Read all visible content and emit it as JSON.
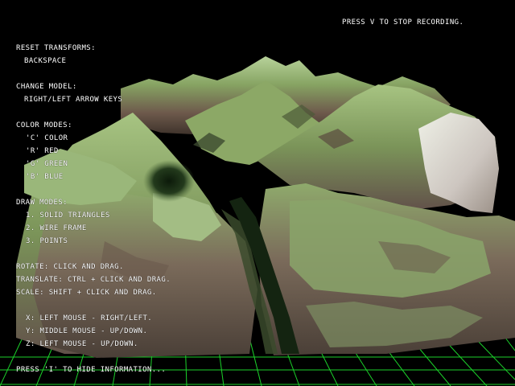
{
  "recording_notice": "PRESS V TO STOP RECORDING.",
  "info": {
    "reset_title": "RESET TRANSFORMS:",
    "reset_key": "BACKSPACE",
    "change_model_title": "CHANGE MODEL:",
    "change_model_keys": "RIGHT/LEFT ARROW KEYS",
    "color_modes_title": "COLOR MODES:",
    "color_modes": [
      "'C' COLOR",
      "'R' RED",
      "'G' GREEN",
      "'B' BLUE"
    ],
    "draw_modes_title": "DRAW MODES:",
    "draw_modes": [
      "1. SOLID TRIANGLES",
      "2. WIRE FRAME",
      "3. POINTS"
    ],
    "rotate": "ROTATE: CLICK AND DRAG.",
    "translate": "TRANSLATE: CTRL + CLICK AND DRAG.",
    "scale": "SCALE: SHIFT + CLICK AND DRAG.",
    "axes": [
      "X: LEFT MOUSE - RIGHT/LEFT.",
      "Y: MIDDLE MOUSE - UP/DOWN.",
      "Z: LEFT MOUSE - UP/DOWN."
    ],
    "hide_hint": "PRESS 'I' TO HIDE INFORMATION..."
  },
  "colors": {
    "background": "#000000",
    "grid": "#1bd12a",
    "terrain_high": "#a9c58a",
    "terrain_mid": "#6f8a4c",
    "terrain_low": "#5b4a3f",
    "terrain_valley": "#152512",
    "snow": "#d8d4d0",
    "text": "#ffffff"
  },
  "view": {
    "model": "terrain heightmap",
    "draw_mode": "solid triangles",
    "color_mode": "color",
    "recording": true
  }
}
